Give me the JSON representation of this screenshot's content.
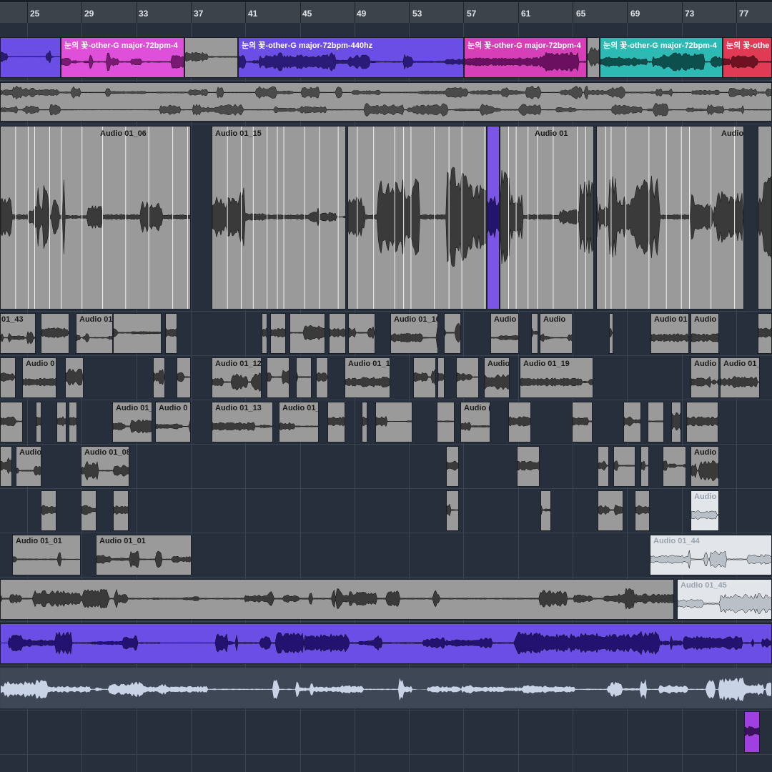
{
  "ruler": {
    "bars": [
      "25",
      "29",
      "33",
      "37",
      "41",
      "45",
      "49",
      "53",
      "57",
      "61",
      "65",
      "69",
      "73",
      "77"
    ]
  },
  "colors": {
    "background": "#262f3b",
    "ruler": "#3d434b",
    "event_gray": "#9a9a9a",
    "event_selected": "#7a55e6",
    "event_inactive": "#e2e6eb",
    "clip_purple": "#6b4ee6",
    "clip_magenta": "#e04fd9",
    "clip_teal": "#2dbab5",
    "clip_red": "#e03a55",
    "clip_violet": "#a040e0"
  },
  "tracks": {
    "track1": {
      "clip_a": "눈의 꽃-other-G major-72bpm-4",
      "clip_b": "눈의 꽃-other-G major-72bpm-440hz",
      "clip_c": "눈의 꽃-other-G major-72bpm-4",
      "clip_d": "눈의 꽃-other-G major-72bpm-4",
      "clip_e": "눈의 꽃-othe"
    },
    "track3": {
      "ev1": "Audio 01_06",
      "ev2": "Audio 01_15",
      "ev3": "Audio 01",
      "ev4": "Audio"
    },
    "track4": {
      "ev1": "01_43",
      "ev2": "Audio 01",
      "ev3": "Audio 01_16",
      "ev4": "Audio",
      "ev5": "Audio",
      "ev6": "Audio 01",
      "ev7": "Audio"
    },
    "track5": {
      "ev1": "Audio 0",
      "ev2": "Audio 01_12",
      "ev3": "Audio 01_1",
      "ev4": "Audio",
      "ev5": "Audio 01_19",
      "ev6": "Audio",
      "ev7": "Audio 01_"
    },
    "track6": {
      "ev1": "Audio 01_",
      "ev2": "Audio 0",
      "ev3": "Audio 01_13",
      "ev4": "Audio 01_",
      "ev5": "Audio ("
    },
    "track7": {
      "ev1": "Audio",
      "ev2": "Audio 01_08",
      "ev3": "Audio"
    },
    "track8": {
      "ev1": "Audio"
    },
    "track9": {
      "ev1": "Audio 01_01",
      "ev2": "Audio 01_01",
      "ev3": "Audio 01_44"
    },
    "track10": {
      "ev1": "Audio 01_45"
    }
  }
}
